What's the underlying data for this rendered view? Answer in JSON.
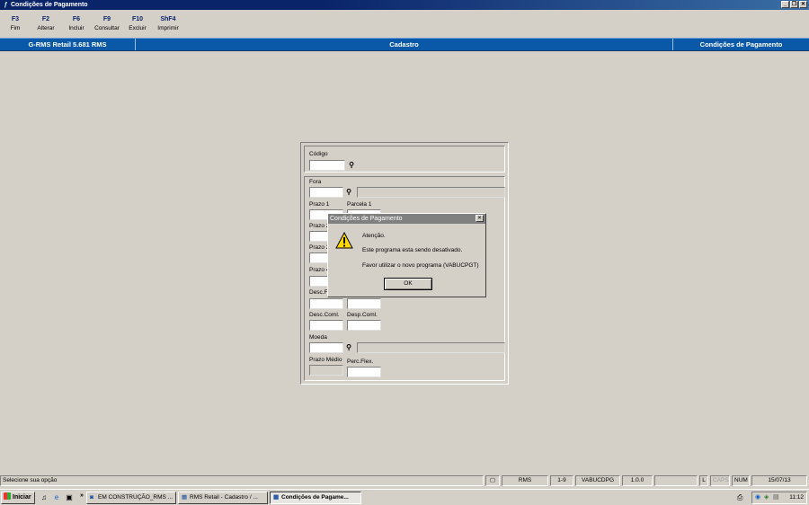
{
  "window": {
    "title": "Condições de Pagamento",
    "buttons": [
      "_",
      "❐",
      "✕"
    ]
  },
  "toolbar": {
    "keys": [
      {
        "key": "F3",
        "label": "Fim"
      },
      {
        "key": "F2",
        "label": "Alterar"
      },
      {
        "key": "F6",
        "label": "Incluir"
      },
      {
        "key": "F9",
        "label": "Consultar"
      },
      {
        "key": "F10",
        "label": "Excluir"
      },
      {
        "key": "ShF4",
        "label": "Imprimir"
      }
    ]
  },
  "header": {
    "app": "G-RMS Retail 5.681 RMS",
    "section": "Cadastro",
    "screen": "Condições de Pagamento"
  },
  "form": {
    "codigo_label": "Código",
    "fora_label": "Fora",
    "prazo1_label": "Prazo 1",
    "parcela1_label": "Parcela 1",
    "prazo2_label": "Prazo 2",
    "prazo3_label": "Prazo 3",
    "prazo4_label": "Prazo 4",
    "descf_label": "Desc.F",
    "desccoml_label": "Desc.Coml.",
    "despcoml_label": "Desp.Coml.",
    "moeda_label": "Moeda",
    "prazomedio_label": "Prazo Médio",
    "percflex_label": "Perc.Flex."
  },
  "dialog": {
    "title": "Condições de Pagamento",
    "line1": "Atenção.",
    "line2": "Este programa esta sendo desativado.",
    "line3": "Favor utilizar o novo programa (VABUCPGT)",
    "ok_label": "OK"
  },
  "statusbar": {
    "message": "Selecione sua opção",
    "system": "RMS",
    "range": "1-9",
    "program": "VABUCDPG",
    "version": "1.0.0",
    "l": "L",
    "caps": "CAPS",
    "num": "NUM",
    "date": "15/07/13"
  },
  "taskbar": {
    "start_label": "Iniciar",
    "tasks": [
      {
        "label": "EM CONSTRUÇÃO_RMS ...",
        "active": false
      },
      {
        "label": "RMS Retail - Cadastro / ...",
        "active": false
      },
      {
        "label": "Condições de Pagame...",
        "active": true
      }
    ],
    "clock": "11:12"
  }
}
